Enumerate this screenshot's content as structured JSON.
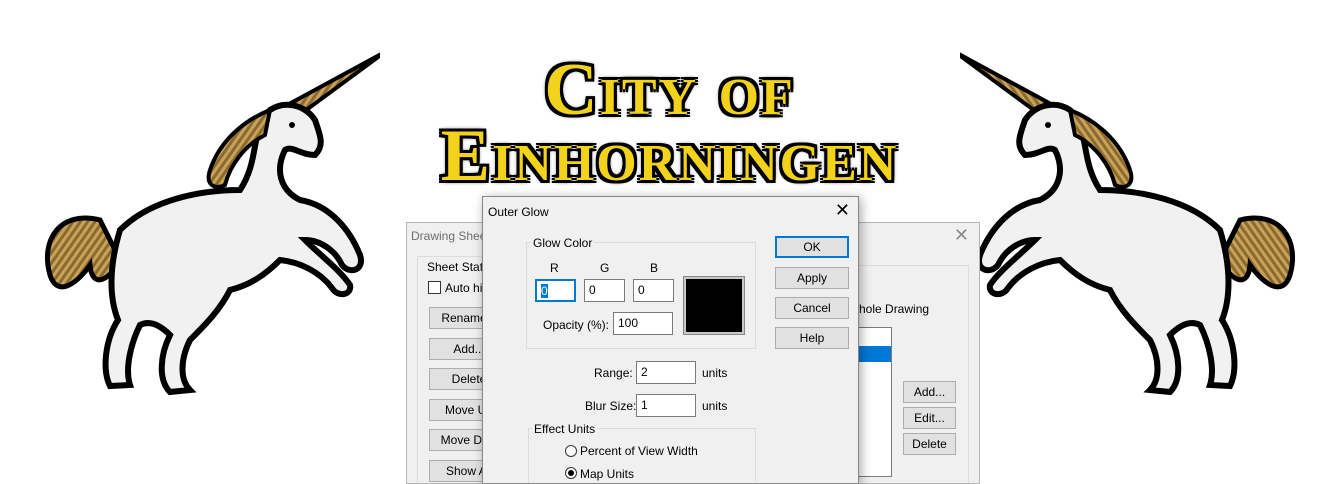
{
  "banner": {
    "line1": "City of",
    "line2": "Einhorningen"
  },
  "colors": {
    "title_fill": "#f2d21b",
    "title_outline": "#000000",
    "dialog_bg": "#f0f0f0",
    "focus_blue": "#0078d7",
    "selection_blue": "#0078d7"
  },
  "icons": {
    "left": "unicorn-left-icon",
    "right": "unicorn-right-icon",
    "close": "close-icon"
  },
  "drawing_sheets_dialog": {
    "title": "Drawing Sheet",
    "group_label": "Sheet Statu",
    "auto_hide_label": "Auto hid",
    "auto_hide_checked": false,
    "buttons": {
      "rename": "Rename...",
      "add_left": "Add...",
      "delete_left": "Delete",
      "move_up": "Move Up",
      "move_down": "Move Dow",
      "show_all": "Show All",
      "add_right": "Add...",
      "edit_right": "Edit...",
      "delete_right": "Delete"
    },
    "whole_drawing_label": "hole Drawing"
  },
  "outer_glow_dialog": {
    "title": "Outer Glow",
    "glow_color_group": "Glow Color",
    "r_label": "R",
    "g_label": "G",
    "b_label": "B",
    "r_value": "0",
    "g_value": "0",
    "b_value": "0",
    "swatch_color": "#000000",
    "opacity_label": "Opacity (%):",
    "opacity_value": "100",
    "range_label": "Range:",
    "range_value": "2",
    "range_units": "units",
    "blur_label": "Blur Size:",
    "blur_value": "1",
    "blur_units": "units",
    "effect_units_group": "Effect Units",
    "radio_percent": "Percent of View Width",
    "radio_map": "Map Units",
    "selected_unit": "Map Units",
    "buttons": {
      "ok": "OK",
      "apply": "Apply",
      "cancel": "Cancel",
      "help": "Help"
    }
  }
}
